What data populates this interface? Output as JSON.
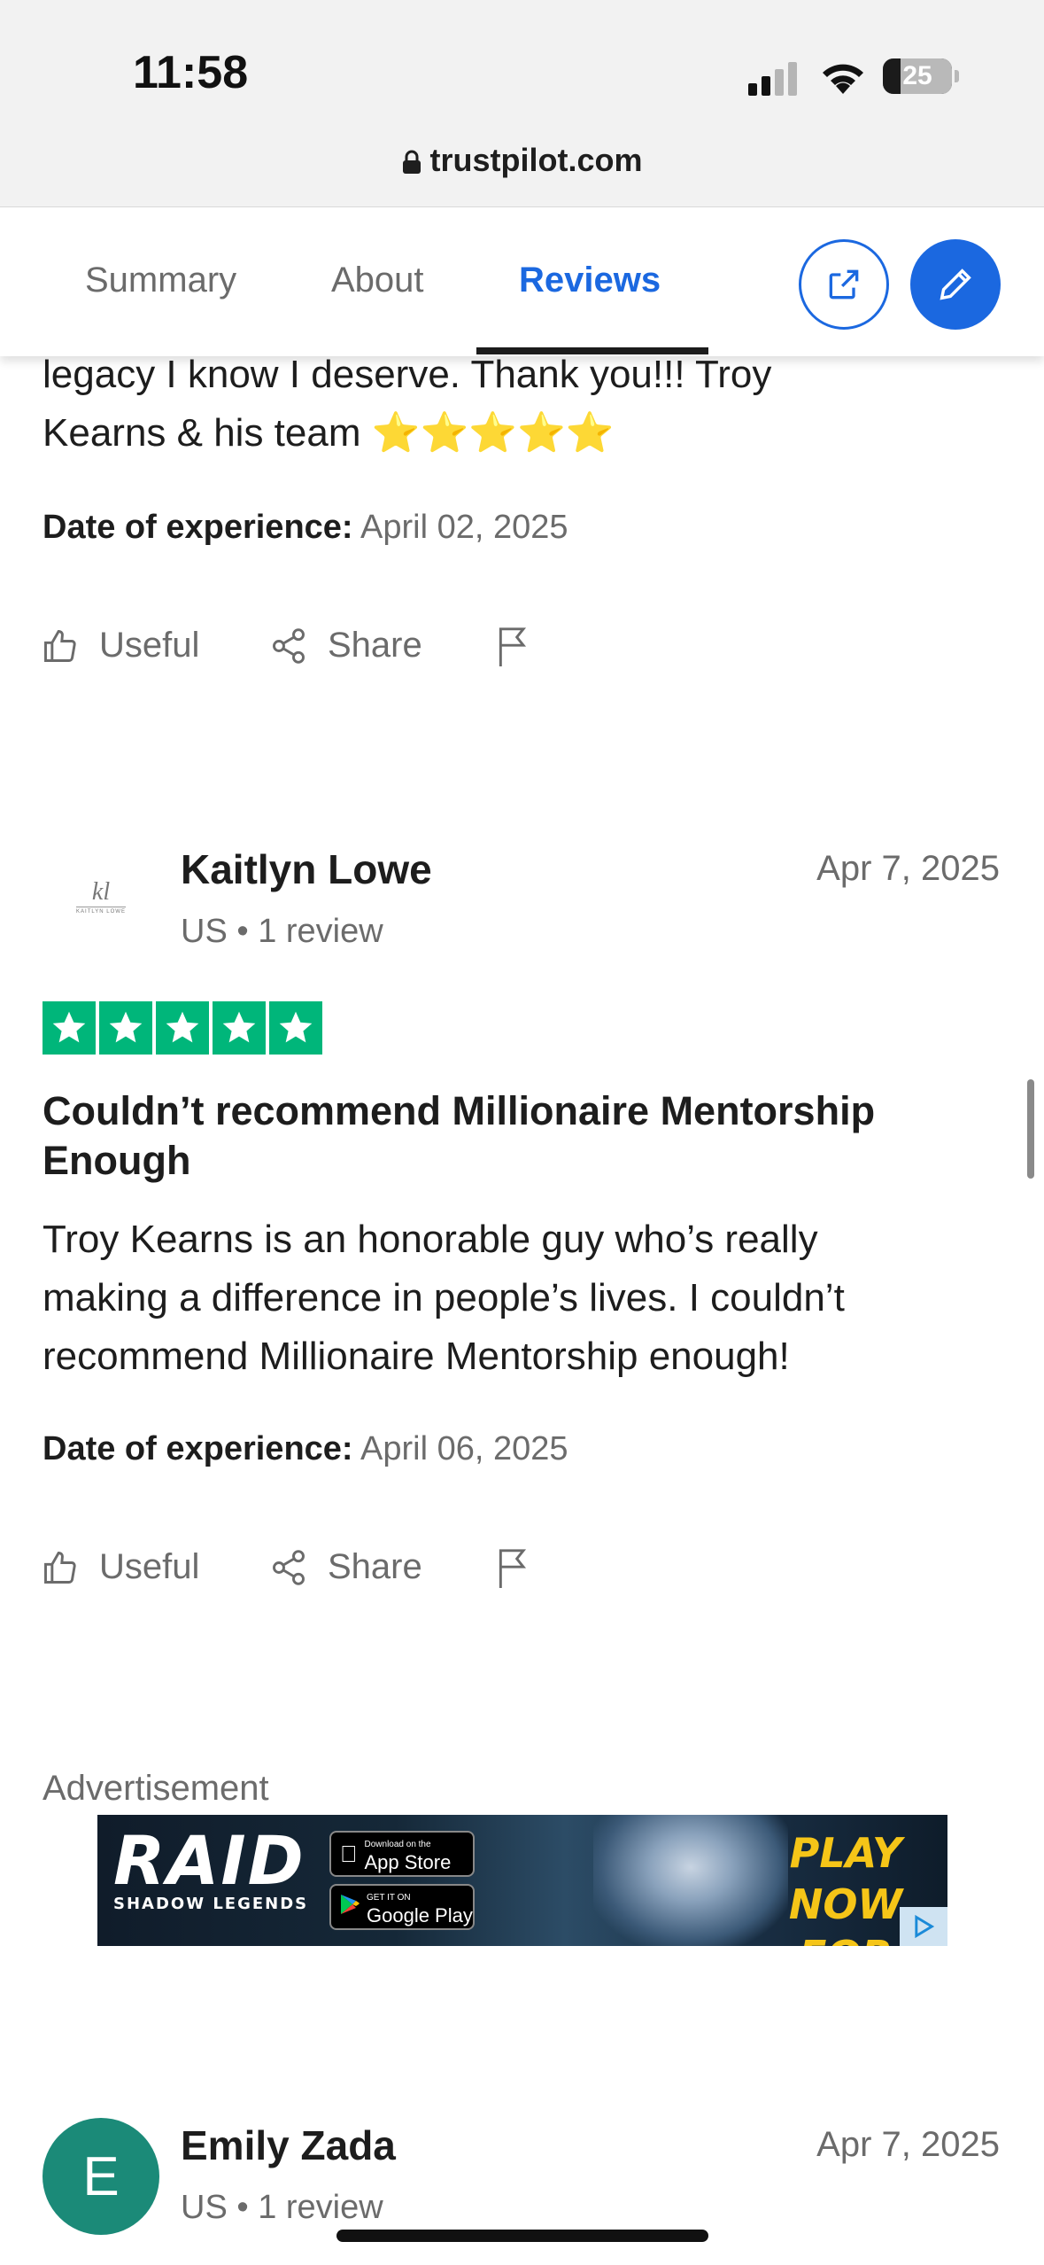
{
  "status_bar": {
    "time": "11:58",
    "battery": "25"
  },
  "browser": {
    "url": "trustpilot.com"
  },
  "tabs": [
    {
      "label": "Summary"
    },
    {
      "label": "About"
    },
    {
      "label": "Reviews"
    }
  ],
  "review_prev": {
    "text_line1": "legacy I know I deserve. Thank you!!! Troy",
    "text_line2": "Kearns & his team ⭐⭐⭐⭐⭐",
    "date_label": "Date of experience:",
    "date_value": "April 02, 2025",
    "useful": "Useful",
    "share": "Share"
  },
  "review_kaitlyn": {
    "name": "Kaitlyn Lowe",
    "meta": "US • 1 review",
    "posted": "Apr 7, 2025",
    "rating": 5,
    "avatar_text": "kl",
    "avatar_subtext": "KAITLYN LOWE",
    "title": "Couldn’t recommend Millionaire Mentorship Enough",
    "body_line1": "Troy Kearns is an honorable guy who’s really",
    "body_line2": "making a difference in people’s lives. I couldn’t",
    "body_line3": "recommend Millionaire Mentorship enough!",
    "date_label": "Date of experience:",
    "date_value": "April 06, 2025",
    "useful": "Useful",
    "share": "Share"
  },
  "advertisement": {
    "label": "Advertisement",
    "brand": "RAID",
    "brand_sub": "SHADOW LEGENDS",
    "app_store": "App Store",
    "app_store_small": "Download on the",
    "google_play": "Google Play",
    "google_play_small": "GET IT ON",
    "cta_line1": "PLAY NOW",
    "cta_line2": "FOR FREE"
  },
  "review_emily": {
    "name": "Emily Zada",
    "meta": "US • 1 review",
    "posted": "Apr 7, 2025",
    "avatar_letter": "E"
  },
  "colors": {
    "accent": "#1b68e0",
    "star_green": "#00b67a",
    "avatar_teal": "#1b8a78"
  }
}
